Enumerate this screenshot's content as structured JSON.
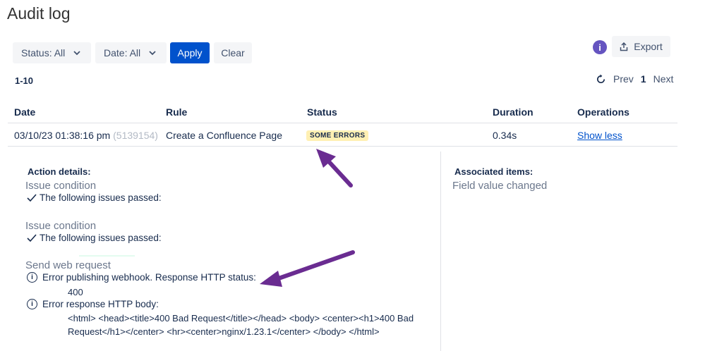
{
  "page": {
    "title": "Audit log"
  },
  "filters": {
    "status": "Status: All",
    "date": "Date: All",
    "apply": "Apply",
    "clear": "Clear"
  },
  "toolbar": {
    "info": "i",
    "export": "Export"
  },
  "pagination": {
    "range": "1-10",
    "prev": "Prev",
    "page": "1",
    "next": "Next"
  },
  "table": {
    "headers": [
      "Date",
      "Rule",
      "Status",
      "Duration",
      "Operations"
    ],
    "row": {
      "date": "03/10/23 01:38:16 pm",
      "id": "(5139154)",
      "rule": "Create a Confluence Page",
      "status": "SOME ERRORS",
      "duration": "0.34s",
      "operation": "Show less"
    }
  },
  "details": {
    "action_title": "Action details:",
    "cond1_title": "Issue condition",
    "cond1_text": "The following issues passed:",
    "cond2_title": "Issue condition",
    "cond2_text": "The following issues passed:",
    "web_title": "Send web request",
    "error1": "Error publishing webhook. Response HTTP status:",
    "error1_value": "400",
    "error2": "Error response HTTP body:",
    "error2_line1": "<html> <head><title>400 Bad Request</title></head> <body> <center><h1>400 Bad",
    "error2_line2": "Request</h1></center> <hr><center>nginx/1.23.1</center> </body> </html>",
    "assoc_title": "Associated items:",
    "assoc_text": "Field value changed"
  },
  "colors": {
    "primary": "#0052cc",
    "lozenge_bg": "#fff0b3",
    "info": "#6554c0",
    "annotation_arrow": "#6a2c91"
  }
}
